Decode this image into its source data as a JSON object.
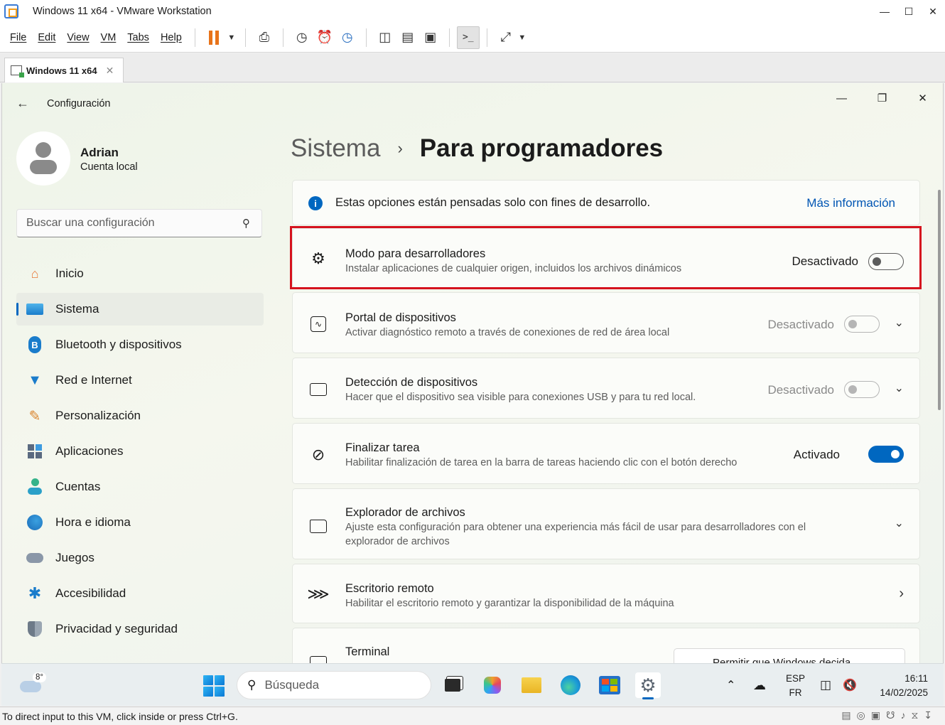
{
  "vmware": {
    "title": "Windows 11 x64 - VMware Workstation",
    "menus": [
      "File",
      "Edit",
      "View",
      "VM",
      "Tabs",
      "Help"
    ],
    "tab_label": "Windows 11 x64",
    "status_message": "To direct input to this VM, click inside or press Ctrl+G."
  },
  "settings": {
    "app_title": "Configuración",
    "user": {
      "name": "Adrian",
      "account": "Cuenta local"
    },
    "search_placeholder": "Buscar una configuración",
    "nav": [
      {
        "label": "Inicio",
        "icon": "home-icon"
      },
      {
        "label": "Sistema",
        "icon": "system-icon"
      },
      {
        "label": "Bluetooth y dispositivos",
        "icon": "bluetooth-icon"
      },
      {
        "label": "Red e Internet",
        "icon": "wifi-icon"
      },
      {
        "label": "Personalización",
        "icon": "brush-icon"
      },
      {
        "label": "Aplicaciones",
        "icon": "apps-icon"
      },
      {
        "label": "Cuentas",
        "icon": "account-icon"
      },
      {
        "label": "Hora e idioma",
        "icon": "clock-globe-icon"
      },
      {
        "label": "Juegos",
        "icon": "gamepad-icon"
      },
      {
        "label": "Accesibilidad",
        "icon": "accessibility-icon"
      },
      {
        "label": "Privacidad y seguridad",
        "icon": "shield-icon"
      }
    ],
    "breadcrumb": {
      "parent": "Sistema",
      "current": "Para programadores"
    },
    "info_banner": {
      "text": "Estas opciones están pensadas solo con fines de desarrollo.",
      "link": "Más información"
    },
    "cards": {
      "dev_mode": {
        "title": "Modo para desarrolladores",
        "desc": "Instalar aplicaciones de cualquier origen, incluidos los archivos dinámicos",
        "state": "Desactivado"
      },
      "device_portal": {
        "title": "Portal de dispositivos",
        "desc": "Activar diagnóstico remoto a través de conexiones de red de área local",
        "state": "Desactivado"
      },
      "device_discovery": {
        "title": "Detección de dispositivos",
        "desc": "Hacer que el dispositivo sea visible para conexiones USB y para tu red local.",
        "state": "Desactivado"
      },
      "end_task": {
        "title": "Finalizar tarea",
        "desc": "Habilitar finalización de tarea en la barra de tareas haciendo clic con el botón derecho",
        "state": "Activado"
      },
      "file_explorer": {
        "title": "Explorador de archivos",
        "desc": "Ajuste esta configuración para obtener una experiencia más fácil de usar para desarrolladores con el explorador de archivos"
      },
      "remote_desktop": {
        "title": "Escritorio remoto",
        "desc": "Habilitar el escritorio remoto y garantizar la disponibilidad de la máquina"
      },
      "terminal": {
        "title": "Terminal",
        "button": "Permitir que Windows decida"
      }
    }
  },
  "taskbar": {
    "weather_temp": "8°",
    "search_placeholder": "Búsqueda",
    "lang_top": "ESP",
    "lang_bottom": "FR",
    "time": "16:11",
    "date": "14/02/2025"
  },
  "colors": {
    "accent": "#0067c0",
    "highlight": "#d5121e",
    "vm_pause": "#e8731a"
  }
}
